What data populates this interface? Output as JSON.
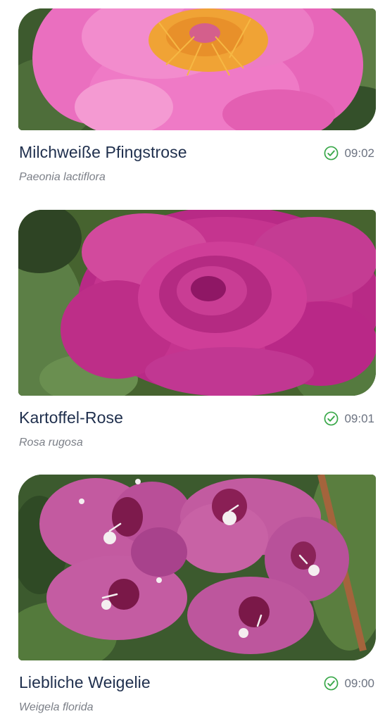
{
  "observations": [
    {
      "common_name": "Milchweiße Pfingstrose",
      "scientific_name": "Paeonia lactiflora",
      "time": "09:02",
      "status_icon": "check-circle-icon",
      "colors": {
        "petal": "#e866b8",
        "center": "#f0a030"
      }
    },
    {
      "common_name": "Kartoffel-Rose",
      "scientific_name": "Rosa rugosa",
      "time": "09:01",
      "status_icon": "check-circle-icon",
      "colors": {
        "petal": "#c02a8c",
        "center": "#8e1565"
      }
    },
    {
      "common_name": "Liebliche Weigelie",
      "scientific_name": "Weigela florida",
      "time": "09:00",
      "status_icon": "check-circle-icon",
      "colors": {
        "petal": "#c4589f",
        "center": "#7a1848"
      }
    }
  ],
  "colors": {
    "title": "#1f2f4d",
    "subtitle": "#7b7f87",
    "time": "#6b7280",
    "verified": "#3aa84a"
  }
}
